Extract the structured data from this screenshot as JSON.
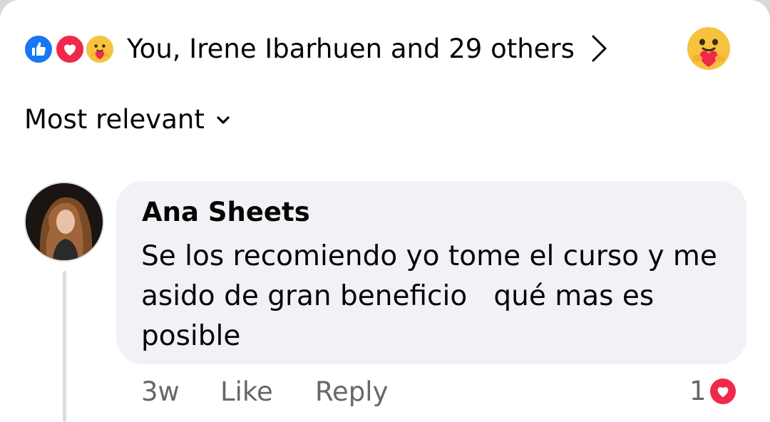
{
  "reactions": {
    "icons": [
      "like-icon",
      "love-icon",
      "care-icon"
    ],
    "summary_text": "You, Irene Ibarhuen and 29 others",
    "my_reaction_icon": "care-icon"
  },
  "sort": {
    "label": "Most relevant"
  },
  "comment": {
    "author": "Ana Sheets",
    "text": "Se los recomiendo yo tome el curso y me asido de gran beneficio   qué mas es posible",
    "time": "3w",
    "like_label": "Like",
    "reply_label": "Reply",
    "reaction_count": "1",
    "reaction_icon": "love-icon"
  },
  "colors": {
    "like_blue": "#1877f2",
    "love_red": "#f0284a",
    "care_yellow": "#f7c23f",
    "bubble_bg": "#f0f2f5",
    "meta_gray": "#65676b"
  }
}
